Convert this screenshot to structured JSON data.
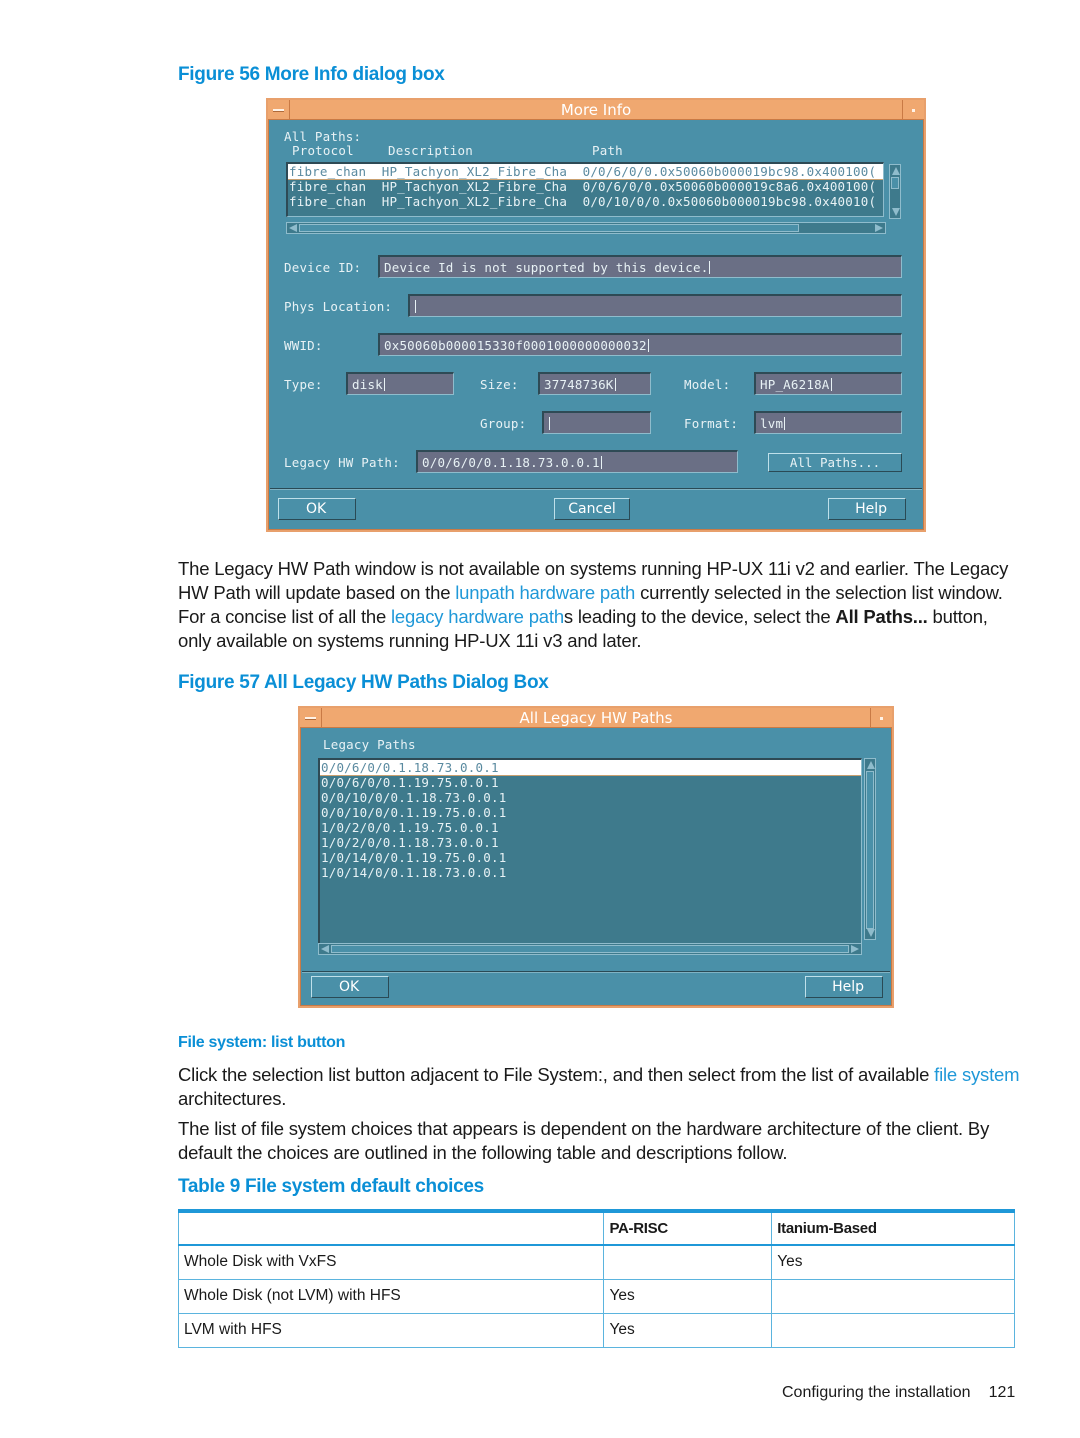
{
  "figure56": {
    "caption": "Figure 56 More Info dialog box",
    "window_title": "More Info",
    "all_paths_label": "All Paths:",
    "columns": [
      "Protocol",
      "Description",
      "Path"
    ],
    "rows": [
      {
        "protocol": "fibre_chan",
        "description": "HP_Tachyon_XL2_Fibre_Cha",
        "path": "0/0/6/0/0.0x50060b000019bc98.0x400100("
      },
      {
        "protocol": "fibre_chan",
        "description": "HP_Tachyon_XL2_Fibre_Cha",
        "path": "0/0/6/0/0.0x50060b000019c8a6.0x400100("
      },
      {
        "protocol": "fibre_chan",
        "description": "HP_Tachyon_XL2_Fibre_Cha",
        "path": "0/0/10/0/0.0x50060b000019bc98.0x40010("
      }
    ],
    "fields": {
      "device_id": {
        "label": "Device ID:",
        "value": "Device Id is not supported by this device."
      },
      "phys_location": {
        "label": "Phys Location:",
        "value": ""
      },
      "wwid": {
        "label": "WWID:",
        "value": "0x50060b000015330f0001000000000032"
      },
      "type": {
        "label": "Type:",
        "value": "disk"
      },
      "size": {
        "label": "Size:",
        "value": "37748736K"
      },
      "model": {
        "label": "Model:",
        "value": "HP_A6218A"
      },
      "group": {
        "label": "Group:",
        "value": ""
      },
      "format": {
        "label": "Format:",
        "value": "lvm"
      },
      "legacy_hw_path": {
        "label": "Legacy HW Path:",
        "value": "0/0/6/0/0.1.18.73.0.0.1"
      }
    },
    "all_paths_button": "All Paths...",
    "buttons": {
      "ok": "OK",
      "cancel": "Cancel",
      "help": "Help"
    }
  },
  "paragraph1": {
    "part1": "The Legacy HW Path window is not available on systems running HP-UX 11i v2 and earlier. The Legacy HW Path will update based on the ",
    "link1": "lunpath hardware path",
    "part2": " currently selected in the selection list window. For a concise list of all the ",
    "link2": "legacy hardware path",
    "part3": "s leading to the device, select the ",
    "bold": "All Paths...",
    "part4": " button, only available on systems running HP-UX 11i v3 and later."
  },
  "figure57": {
    "caption": "Figure 57 All Legacy HW Paths Dialog Box",
    "window_title": "All Legacy HW Paths",
    "list_label": "Legacy Paths",
    "paths": [
      "0/0/6/0/0.1.18.73.0.0.1",
      "0/0/6/0/0.1.19.75.0.0.1",
      "0/0/10/0/0.1.18.73.0.0.1",
      "0/0/10/0/0.1.19.75.0.0.1",
      "1/0/2/0/0.1.19.75.0.0.1",
      "1/0/2/0/0.1.18.73.0.0.1",
      "1/0/14/0/0.1.19.75.0.0.1",
      "1/0/14/0/0.1.18.73.0.0.1"
    ],
    "selected_index": 0,
    "buttons": {
      "ok": "OK",
      "help": "Help"
    }
  },
  "section": {
    "heading": "File system: list button",
    "para2": {
      "part1": "Click the selection list button adjacent to File System:, and then select from the list of available ",
      "link": "file system",
      "part2": " architectures."
    },
    "para3": "The list of file system choices that appears is dependent on the hardware architecture of the client. By default the choices are outlined in the following table and descriptions follow."
  },
  "table9": {
    "caption": "Table 9 File system default choices",
    "headers": [
      "",
      "PA-RISC",
      "Itanium-Based"
    ],
    "rows": [
      [
        "Whole Disk with VxFS",
        "",
        "Yes"
      ],
      [
        "Whole Disk (not LVM) with HFS",
        "Yes",
        ""
      ],
      [
        "LVM with HFS",
        "Yes",
        ""
      ]
    ]
  },
  "footer": {
    "section": "Configuring the installation",
    "page": "121"
  }
}
